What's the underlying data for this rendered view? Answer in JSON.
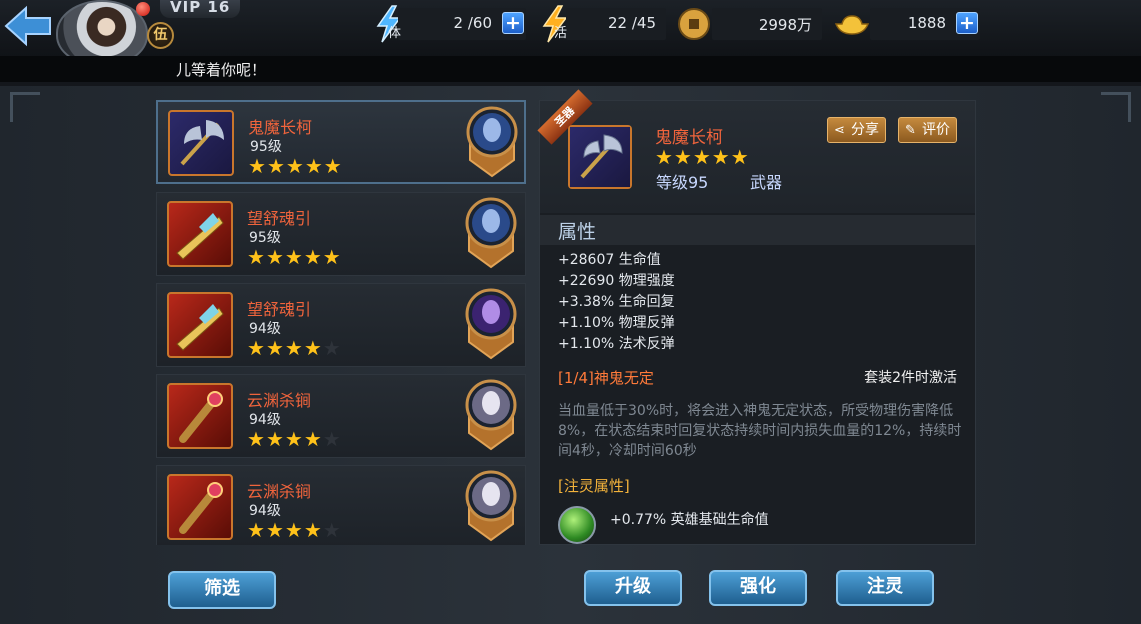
{
  "header": {
    "vip": "VIP 16",
    "rank_badge": "伍",
    "resources": [
      {
        "tag": "体",
        "value": "2 /60",
        "has_plus": true,
        "icon": "lightning-stamina-icon",
        "color": "#4fb6ff"
      },
      {
        "tag": "活",
        "value": "22 /45",
        "has_plus": false,
        "icon": "lightning-vitality-icon",
        "color": "#ffb020"
      },
      {
        "tag": "",
        "value": "2998万",
        "has_plus": false,
        "icon": "copper-coin-icon",
        "color": "#d9a23e"
      },
      {
        "tag": "",
        "value": "1888",
        "has_plus": true,
        "icon": "gold-ingot-icon",
        "color": "#f3c23a"
      }
    ],
    "plus_label": "+"
  },
  "marquee": {
    "text": "儿等着你呢！"
  },
  "list": {
    "items": [
      {
        "name": "鬼魔长柯",
        "level": "95级",
        "stars": 5,
        "icon": "axe-weapon-icon",
        "hero": "blue-knight-hero-icon",
        "selected": true
      },
      {
        "name": "望舒魂引",
        "level": "95级",
        "stars": 5,
        "icon": "golden-blade-weapon-icon",
        "hero": "blue-knight-hero-icon",
        "selected": false
      },
      {
        "name": "望舒魂引",
        "level": "94级",
        "stars": 4,
        "icon": "golden-blade-weapon-icon",
        "hero": "purple-warrior-hero-icon",
        "selected": false
      },
      {
        "name": "云渊杀锏",
        "level": "94级",
        "stars": 4,
        "icon": "club-weapon-icon",
        "hero": "silver-hair-hero-icon",
        "selected": false
      },
      {
        "name": "云渊杀锏",
        "level": "94级",
        "stars": 4,
        "icon": "club-weapon-icon",
        "hero": "silver-hair-hero-icon",
        "selected": false
      }
    ],
    "star_char": "★",
    "filter_label": "筛选"
  },
  "detail": {
    "ribbon": "圣器",
    "name": "鬼魔长柯",
    "stars": "★★★★★",
    "level": "等级95",
    "type": "武器",
    "share_label": "分享",
    "rate_label": "评价",
    "attr_title": "属性",
    "attributes": [
      "+28607 生命值",
      "+22690 物理强度",
      "+3.38% 生命回复",
      "+1.10% 物理反弹",
      "+1.10% 法术反弹"
    ],
    "set_name": "[1/4]神鬼无定",
    "set_activation": "套装2件时激活",
    "set_desc": "当血量低于30%时，将会进入神鬼无定状态，所受物理伤害降低8%，在状态结束时回复状态持续时间内损失血量的12%，持续时间4秒，冷却时间60秒",
    "infuse_title": "[注灵属性]",
    "infuse_value": "+0.77% 英雄基础生命值"
  },
  "actions": {
    "upgrade": "升级",
    "enhance": "强化",
    "infuse": "注灵"
  }
}
